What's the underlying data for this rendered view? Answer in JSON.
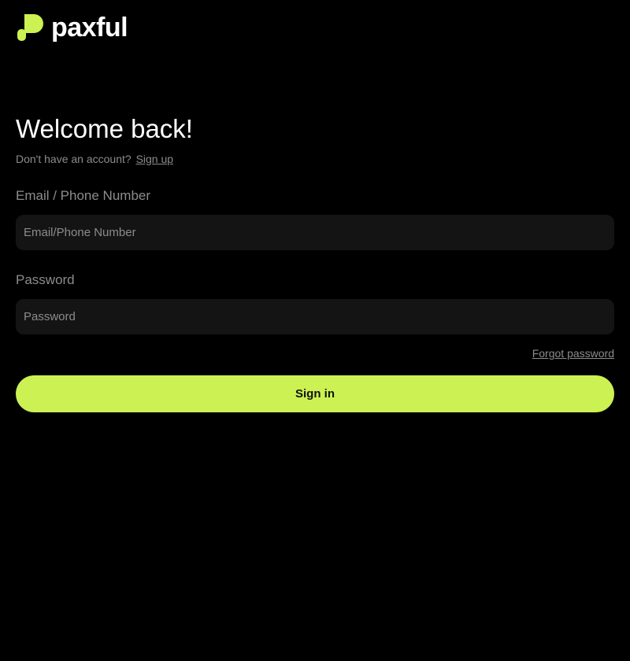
{
  "brand": {
    "name": "paxful",
    "logo_icon": "paxful-logo-icon",
    "accent_color": "#cbf252"
  },
  "login": {
    "title": "Welcome back!",
    "no_account_text": "Don't have an account?",
    "signup_label": "Sign up",
    "email": {
      "label": "Email / Phone Number",
      "placeholder": "Email/Phone Number",
      "value": ""
    },
    "password": {
      "label": "Password",
      "placeholder": "Password",
      "value": ""
    },
    "forgot_password_label": "Forgot password",
    "signin_label": "Sign in"
  }
}
